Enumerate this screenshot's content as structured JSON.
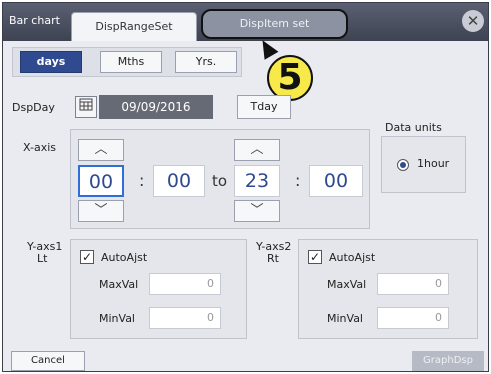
{
  "header": {
    "title": "Bar chart",
    "tabs": [
      {
        "label": "DispRangeSet"
      },
      {
        "label": "DispItem set"
      }
    ],
    "close_glyph": "✕"
  },
  "callout": {
    "number": "5"
  },
  "period": {
    "buttons": [
      {
        "label": "days",
        "selected": true
      },
      {
        "label": "Mths",
        "selected": false
      },
      {
        "label": "Yrs.",
        "selected": false
      }
    ]
  },
  "date": {
    "label": "DspDay",
    "calendar_icon": "calendar-icon",
    "value": "09/09/2016",
    "today_button": "Tday"
  },
  "xaxis": {
    "label": "X-axis",
    "from_hour": "00",
    "from_min": "00",
    "to_text": "to",
    "to_hour": "23",
    "to_min": "00",
    "colon": ":",
    "up_glyph": "︿",
    "down_glyph": "﹀"
  },
  "data_units": {
    "label": "Data units",
    "option": "1hour"
  },
  "yaxis1": {
    "label_line1": "Y-axs1",
    "label_line2": "Lt",
    "auto_label": "AutoAjst",
    "auto_checked": "✓",
    "max_label": "MaxVal",
    "max_value": "0",
    "min_label": "MinVal",
    "min_value": "0"
  },
  "yaxis2": {
    "label_line1": "Y-axs2",
    "label_line2": "Rt",
    "auto_label": "AutoAjst",
    "auto_checked": "✓",
    "max_label": "MaxVal",
    "max_value": "0",
    "min_label": "MinVal",
    "min_value": "0"
  },
  "footer": {
    "cancel": "Cancel",
    "graph": "GraphDsp"
  }
}
